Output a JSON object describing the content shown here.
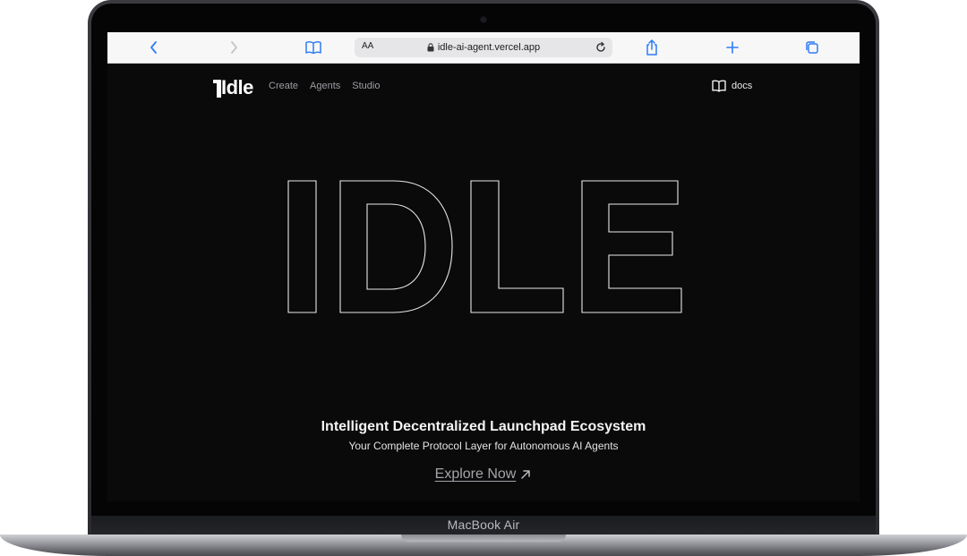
{
  "browser": {
    "reader_label": "AA",
    "url": "idle-ai-agent.vercel.app",
    "accent_color": "#2f7cf6"
  },
  "site": {
    "logo_text": "Idle",
    "nav": [
      "Create",
      "Agents",
      "Studio"
    ],
    "docs_label": "docs",
    "hero_word": "IDLE",
    "tagline": "Intelligent Decentralized Launchpad Ecosystem",
    "sub_tagline": "Your Complete Protocol Layer for Autonomous AI Agents",
    "cta_label": "Explore Now",
    "cta_icon": "arrow-up-right-icon"
  },
  "device": {
    "model_label": "MacBook Air"
  },
  "icons": {
    "back": "chevron-left-icon",
    "forward": "chevron-right-icon",
    "bookmarks": "book-icon",
    "lock": "lock-icon",
    "reload": "reload-icon",
    "share": "share-icon",
    "new_tab": "plus-icon",
    "tabs": "tabs-icon",
    "docs": "book-open-icon"
  }
}
